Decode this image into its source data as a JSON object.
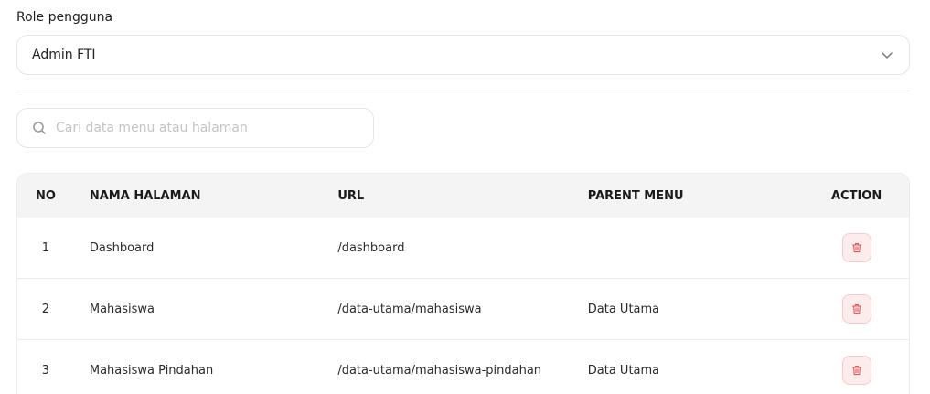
{
  "role": {
    "label": "Role pengguna",
    "selected": "Admin FTI"
  },
  "search": {
    "placeholder": "Cari data menu atau halaman",
    "value": ""
  },
  "table": {
    "headers": {
      "no": "NO",
      "nama": "NAMA HALAMAN",
      "url": "URL",
      "parent": "PARENT MENU",
      "action": "ACTION"
    },
    "rows": [
      {
        "no": "1",
        "nama": "Dashboard",
        "url": "/dashboard",
        "parent": ""
      },
      {
        "no": "2",
        "nama": "Mahasiswa",
        "url": "/data-utama/mahasiswa",
        "parent": "Data Utama"
      },
      {
        "no": "3",
        "nama": "Mahasiswa Pindahan",
        "url": "/data-utama/mahasiswa-pindahan",
        "parent": "Data Utama"
      }
    ]
  },
  "icons": {
    "select": "chevron-down-icon",
    "search": "search-icon",
    "delete": "trash-icon"
  },
  "colors": {
    "delete_icon": "#e25858",
    "delete_bg": "#fdecec",
    "header_bg": "#f4f4f4"
  }
}
